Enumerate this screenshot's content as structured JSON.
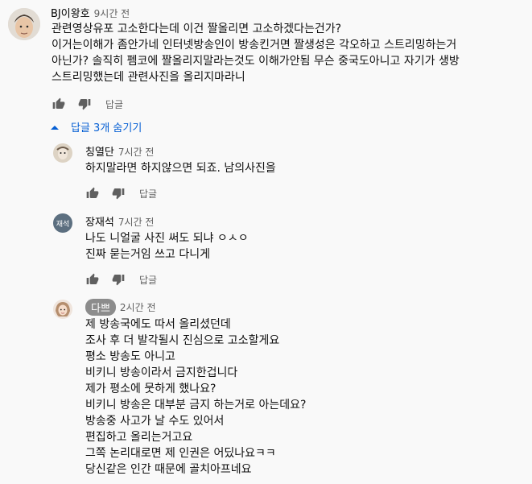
{
  "colors": {
    "background": "#f9f9f9",
    "text": "#0f0f0f",
    "secondary": "#606060",
    "link": "#065fd4",
    "chip": "#8c8c8c"
  },
  "top_comment": {
    "author": "BJ이왕호",
    "time": "9시간 전",
    "lines": [
      "관련영상유포 고소한다는데 이건 짤올리면 고소하겠다는건가?",
      "이거는이해가 좀안가네 인터넷방송인이 방송킨거면 짤생성은 각오하고 스트리밍하는거",
      "아닌가? 솔직히 펨코에 짤올리지말라는것도 이해가안됨 무슨 중국도아니고 자기가 생방",
      "스트리밍했는데 관련사진을 올리지마라니"
    ],
    "reply_label": "답글",
    "like_icon": "thumb-up-icon",
    "dislike_icon": "thumb-down-icon"
  },
  "replies_toggle": {
    "label": "답글 3개 숨기기",
    "icon": "chevron-up-icon"
  },
  "replies": [
    {
      "author": "칭열단",
      "time": "7시간 전",
      "lines": [
        "하지말라면 하지않으면 되죠. 남의사진을"
      ],
      "reply_label": "답글"
    },
    {
      "author": "장재석",
      "avatar_text": "재석",
      "time": "7시간 전",
      "lines": [
        "나도 니얼굴 사진 써도 되냐 ㅇㅅㅇ",
        "진짜 묻는거임 쓰고 다니게"
      ],
      "reply_label": "답글"
    },
    {
      "author": "다쁘",
      "time": "2시간 전",
      "lines": [
        "제 방송국에도 따서 올리셨던데",
        "조사 후 더 발각될시 진심으로 고소할게요",
        "평소 방송도 아니고",
        "비키니 방송이라서 금지한겁니다",
        "제가 평소에 뭇하게 했나요?",
        "비키니 방송은 대부분 금지 하는거로 아는데요?",
        "방송중 사고가 날 수도 있어서",
        "편집하고 올리는거고요",
        "그쪽 논리대로면 제 인권은 어딨나요ㅋㅋ",
        "당신같은 인간 때문에 골치아프네요"
      ]
    }
  ]
}
